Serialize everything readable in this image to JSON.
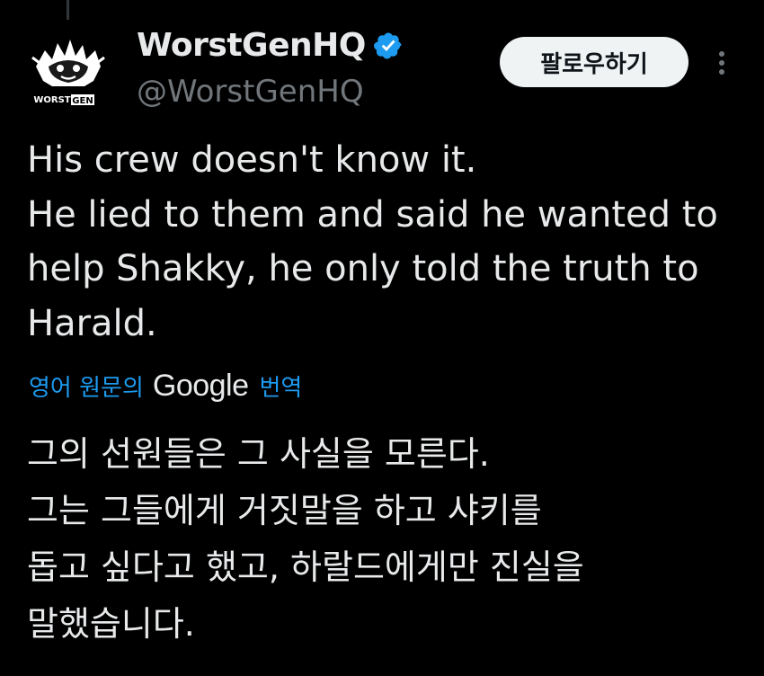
{
  "author": {
    "display_name": "WorstGenHQ",
    "handle": "@WorstGenHQ",
    "verified": true,
    "avatar_text": [
      "WORST",
      "GEN"
    ]
  },
  "actions": {
    "follow_label": "팔로우하기",
    "more_icon": "more-vertical-icon"
  },
  "tweet": {
    "lines": [
      "His crew doesn't know it.",
      "He lied to them and said he wanted to",
      "help Shakky, he only told the truth to",
      "Harald."
    ]
  },
  "translation": {
    "prefix": "영어 원문의",
    "provider": "Google",
    "suffix": "번역",
    "lines": [
      "그의 선원들은 그 사실을 모른다.",
      "그는 그들에게 거짓말을 하고 샤키를",
      "돕고 싶다고 했고, 하랄드에게만 진실을",
      "말했습니다."
    ]
  },
  "colors": {
    "background": "#000000",
    "text_primary": "#e7e9ea",
    "text_secondary": "#71767b",
    "accent_blue": "#1d9bf0",
    "follow_button_bg": "#eff3f4"
  }
}
